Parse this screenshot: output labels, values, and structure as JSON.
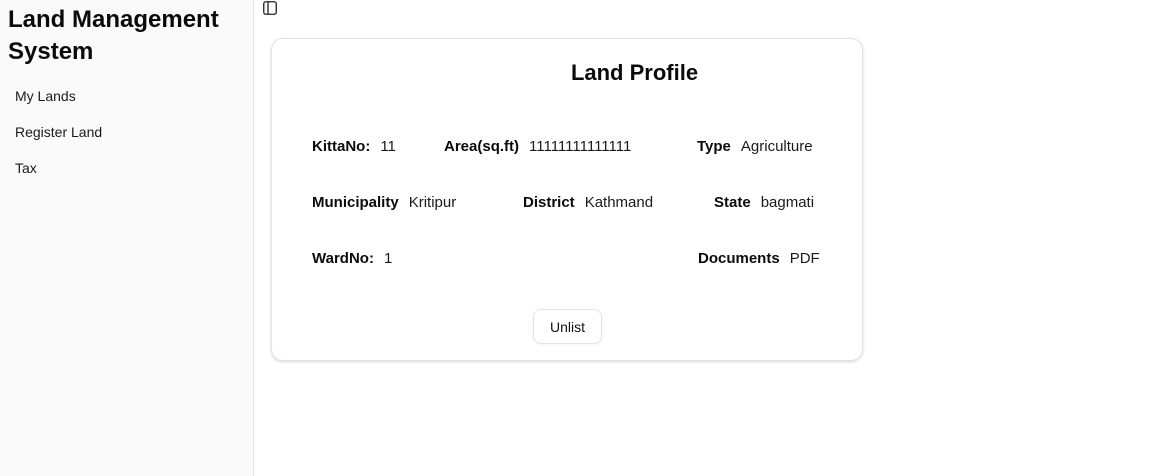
{
  "sidebar": {
    "title": "Land Management System",
    "items": [
      {
        "label": "My Lands"
      },
      {
        "label": "Register Land"
      },
      {
        "label": "Tax"
      }
    ]
  },
  "toolbar": {
    "toggle_icon": "sidebar-panel-icon"
  },
  "profile": {
    "title": "Land Profile",
    "kitta": {
      "label": "KittaNo:",
      "value": "11"
    },
    "area": {
      "label": "Area(sq.ft)",
      "value": "11111111111111"
    },
    "type": {
      "label": "Type",
      "value": "Agriculture"
    },
    "municipality": {
      "label": "Municipality",
      "value": "Kritipur"
    },
    "district": {
      "label": "District",
      "value": "Kathmand"
    },
    "state": {
      "label": "State",
      "value": "bagmati"
    },
    "ward": {
      "label": "WardNo:",
      "value": "1"
    },
    "documents": {
      "label": "Documents",
      "value": "PDF"
    },
    "unlist_label": "Unlist"
  }
}
